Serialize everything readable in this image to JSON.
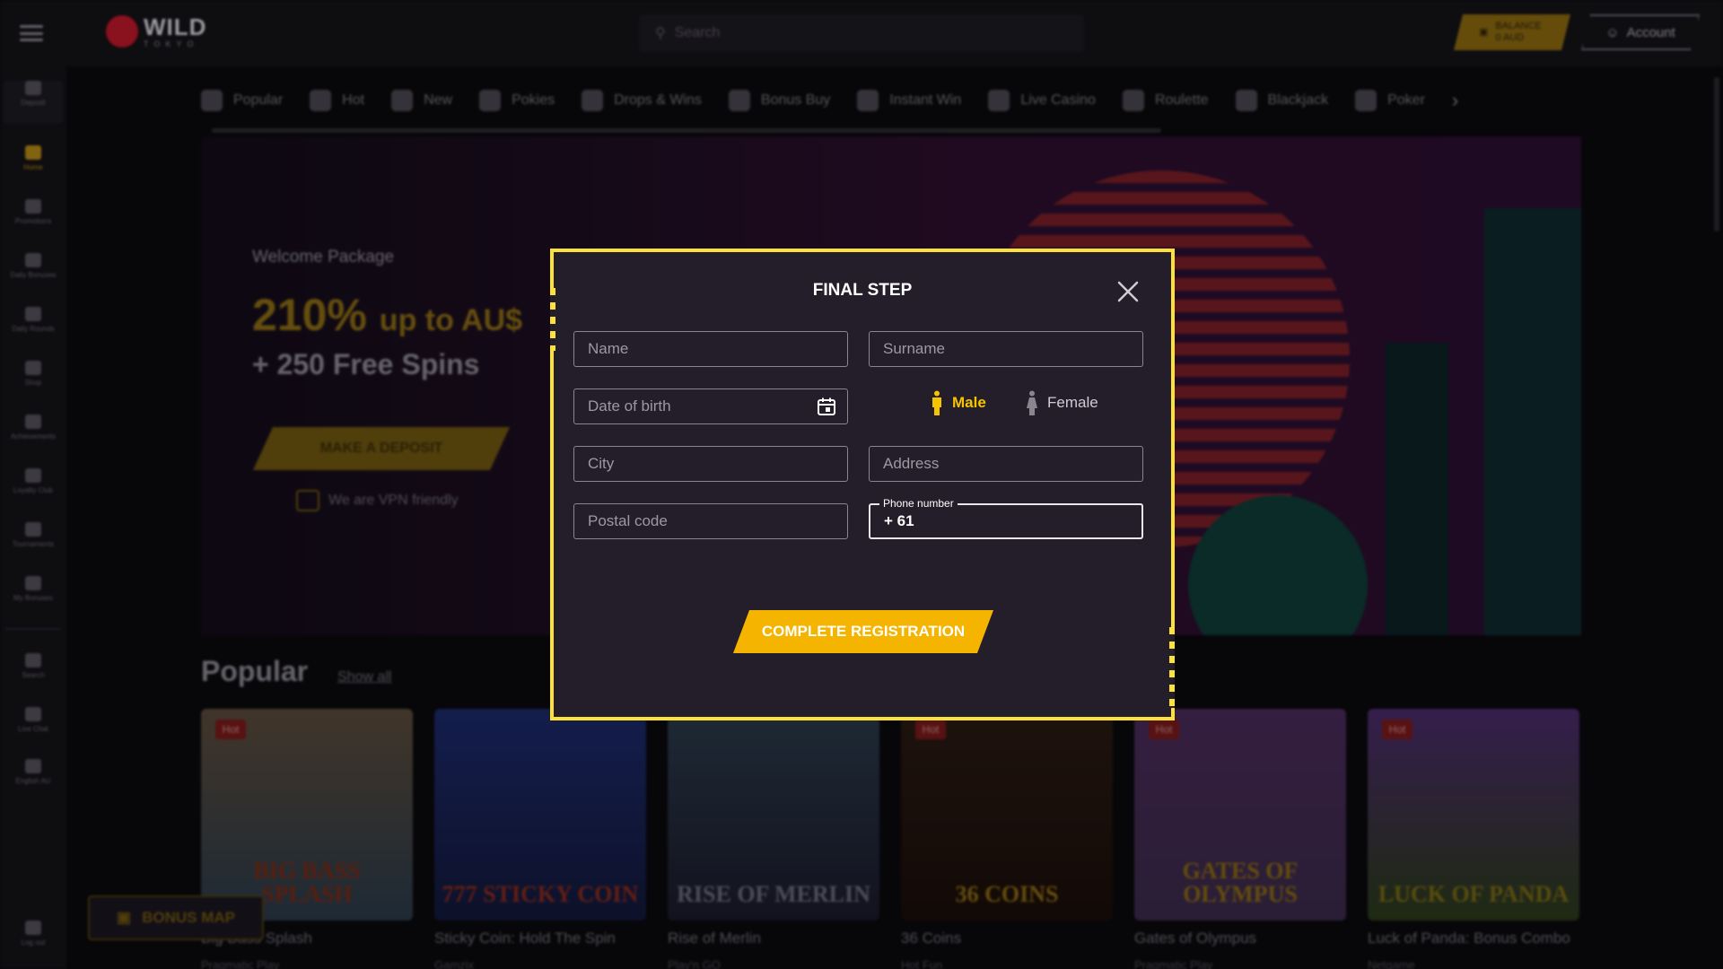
{
  "header": {
    "logo_text": "WILD",
    "logo_sub": "TOKYO",
    "search_placeholder": "Search",
    "balance_label": "BALANCE",
    "balance_value": "0 AUD",
    "account_label": "Account"
  },
  "sidebar": {
    "items": [
      {
        "label": "Deposit"
      },
      {
        "label": "Home"
      },
      {
        "label": "Promotions"
      },
      {
        "label": "Daily Bonuses"
      },
      {
        "label": "Daily Rounds"
      },
      {
        "label": "Shop"
      },
      {
        "label": "Achievements"
      },
      {
        "label": "Loyalty Club"
      },
      {
        "label": "Tournaments"
      },
      {
        "label": "My Bonuses"
      },
      {
        "label": "Search"
      },
      {
        "label": "Live Chat"
      },
      {
        "label": "English AU"
      },
      {
        "label": "Log out"
      }
    ]
  },
  "categories": [
    "Popular",
    "Hot",
    "New",
    "Pokies",
    "Drops & Wins",
    "Bonus Buy",
    "Instant Win",
    "Live Casino",
    "Roulette",
    "Blackjack",
    "Poker"
  ],
  "banner": {
    "label": "Welcome Package",
    "headline_pct": "210%",
    "headline_rest": "up to AU$",
    "spins": "+ 250 Free Spins",
    "cta": "MAKE A DEPOSIT",
    "vpn": "We are VPN friendly"
  },
  "popular": {
    "title": "Popular",
    "show_all": "Show all",
    "hot_badge": "Hot",
    "games": [
      {
        "name": "Big Bass Splash",
        "provider": "Pragmatic Play",
        "logo": "Big Bass Splash"
      },
      {
        "name": "Sticky Coin: Hold The Spin",
        "provider": "Gamzix",
        "logo": "777 Sticky Coin"
      },
      {
        "name": "Rise of Merlin",
        "provider": "Play'n GO",
        "logo": "Rise of Merlin"
      },
      {
        "name": "36 Coins",
        "provider": "Hot Fun",
        "logo": "36 Coins"
      },
      {
        "name": "Gates of Olympus",
        "provider": "Pragmatic Play",
        "logo": "Gates of Olympus"
      },
      {
        "name": "Luck of Panda: Bonus Combo",
        "provider": "Netgame",
        "logo": "Luck of Panda"
      }
    ]
  },
  "bonus_map": "BONUS MAP",
  "modal": {
    "title": "FINAL STEP",
    "name_placeholder": "Name",
    "surname_placeholder": "Surname",
    "dob_placeholder": "Date of birth",
    "gender_male": "Male",
    "gender_female": "Female",
    "city_placeholder": "City",
    "address_placeholder": "Address",
    "postal_placeholder": "Postal code",
    "phone_label": "Phone number",
    "phone_prefix": "+ 61",
    "submit": "COMPLETE REGISTRATION"
  },
  "colors": {
    "accent": "#f5b400",
    "modal_border": "#fbe13a",
    "modal_bg": "#231e2a"
  }
}
